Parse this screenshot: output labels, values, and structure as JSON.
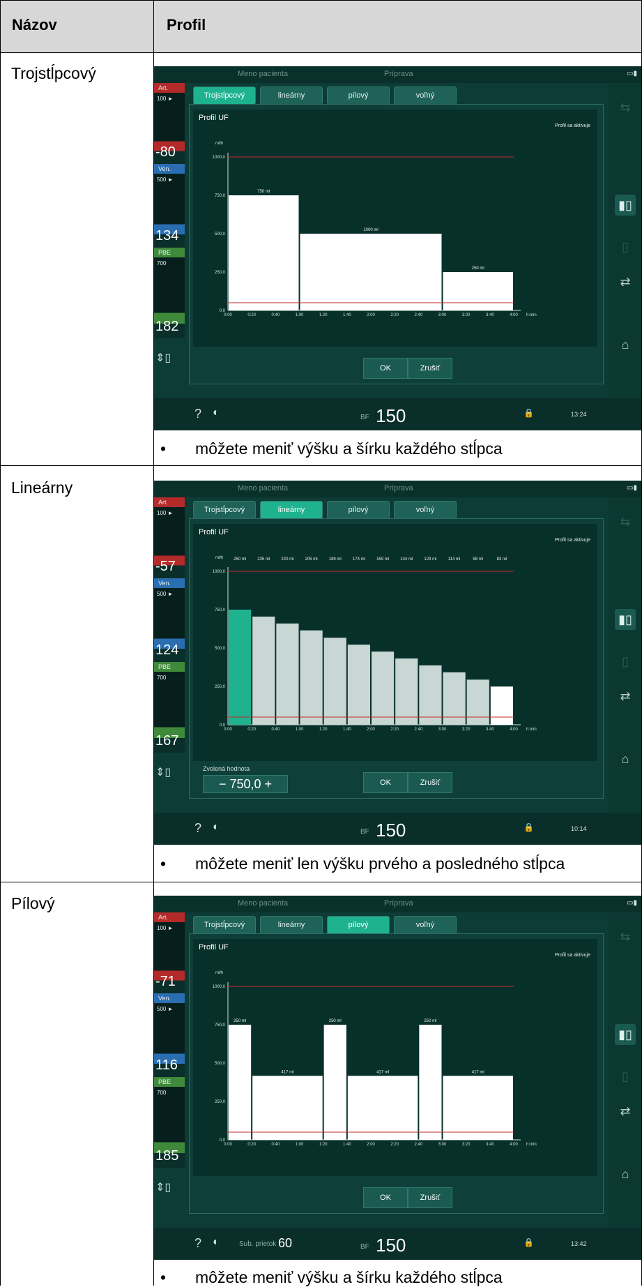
{
  "header": {
    "col1": "Názov",
    "col2": "Profil"
  },
  "rows": [
    {
      "name": "Trojstĺpcový",
      "note": "môžete meniť výšku a šírku každého stĺpca",
      "screen": {
        "patient": "Meno pacienta",
        "phase": "Príprava",
        "tabs": [
          "Trojstĺpcový",
          "lineárny",
          "pílový",
          "voľný"
        ],
        "active_tab": 0,
        "panel_title": "Profil UF",
        "status": "Profil sa aktivuje",
        "art_label": "Art.",
        "art_value": "-80",
        "ven_label": "Ven.",
        "ven_value": "134",
        "pbe_label": "PBE",
        "pbe_value": "182",
        "art_top": "100 ►",
        "ven_top": "500 ►",
        "pbe_top": "700",
        "bf_label": "BF",
        "bf_value": "150",
        "time": "13:24",
        "ok": "OK",
        "cancel": "Zrušiť",
        "bar_labels": [
          "750 ml",
          "1000 ml",
          "250 ml"
        ]
      }
    },
    {
      "name": "Lineárny",
      "note": "môžete meniť len výšku prvého a posledného stĺpca",
      "screen": {
        "patient": "Meno pacienta",
        "phase": "Príprava",
        "tabs": [
          "Trojstĺpcový",
          "lineárny",
          "pílový",
          "voľný"
        ],
        "active_tab": 1,
        "panel_title": "Profil UF",
        "status": "Profil sa aktivuje",
        "art_label": "Art.",
        "art_value": "-57",
        "ven_label": "Ven.",
        "ven_value": "124",
        "pbe_label": "PBE",
        "pbe_value": "167",
        "art_top": "100 ►",
        "ven_top": "500 ►",
        "pbe_top": "700",
        "bf_label": "BF",
        "bf_value": "150",
        "time": "10:14",
        "ok": "OK",
        "cancel": "Zrušiť",
        "selected_label": "Zvolená hodnota",
        "selected_value": "750,0",
        "bar_labels": [
          "250 ml",
          "235 ml",
          "220 ml",
          "205 ml",
          "189 ml",
          "174 ml",
          "159 ml",
          "144 ml",
          "129 ml",
          "114 ml",
          "98 ml",
          "83 ml"
        ]
      }
    },
    {
      "name": "Pílový",
      "note": "môžete meniť výšku a šírku každého stĺpca",
      "screen": {
        "patient": "Meno pacienta",
        "phase": "Príprava",
        "tabs": [
          "Trojstĺpcový",
          "lineárny",
          "pílový",
          "voľný"
        ],
        "active_tab": 2,
        "panel_title": "Profil UF",
        "status": "Profil sa aktivuje",
        "art_label": "Art.",
        "art_value": "-71",
        "ven_label": "Ven.",
        "ven_value": "116",
        "pbe_label": "PBE",
        "pbe_value": "185",
        "art_top": "100 ►",
        "ven_top": "500 ►",
        "pbe_top": "700",
        "bf_label": "BF",
        "bf_value": "150",
        "time": "13:42",
        "sub_label": "Sub. prietok",
        "sub_value": "60",
        "ok": "OK",
        "cancel": "Zrušiť",
        "bar_labels": [
          "250 ml",
          "417 ml",
          "250 ml",
          "417 ml",
          "250 ml",
          "417 ml"
        ]
      }
    }
  ],
  "chart_data": [
    {
      "type": "bar",
      "title": "Profil UF",
      "ylabel": "ml/h",
      "xlabel": "h:min",
      "ylim": [
        0,
        1000
      ],
      "x_ticks": [
        "0:00",
        "0:20",
        "0:40",
        "1:00",
        "1:20",
        "1:40",
        "2:00",
        "2:20",
        "2:40",
        "3:00",
        "3:20",
        "3:40",
        "4:00"
      ],
      "y_ticks": [
        "0,0",
        "250,0",
        "500,0",
        "750,0",
        "1000,0"
      ],
      "segments": [
        {
          "start_min": 0,
          "end_min": 60,
          "value": 750,
          "label": "750 ml"
        },
        {
          "start_min": 60,
          "end_min": 180,
          "value": 500,
          "label": "1000 ml"
        },
        {
          "start_min": 180,
          "end_min": 240,
          "value": 250,
          "label": "250 ml"
        }
      ],
      "limit_line": 1000,
      "min_line": 50
    },
    {
      "type": "bar",
      "title": "Profil UF",
      "ylabel": "ml/h",
      "xlabel": "h:min",
      "ylim": [
        0,
        1000
      ],
      "x_ticks": [
        "0:00",
        "0:20",
        "0:40",
        "1:00",
        "1:20",
        "1:40",
        "2:00",
        "2:20",
        "2:40",
        "3:00",
        "3:20",
        "3:40",
        "4:00"
      ],
      "y_ticks": [
        "0,0",
        "250,0",
        "500,0",
        "750,0",
        "1000,0"
      ],
      "segments": [
        {
          "start_min": 0,
          "end_min": 20,
          "value": 750,
          "label": "250 ml"
        },
        {
          "start_min": 20,
          "end_min": 40,
          "value": 705,
          "label": "235 ml"
        },
        {
          "start_min": 40,
          "end_min": 60,
          "value": 660,
          "label": "220 ml"
        },
        {
          "start_min": 60,
          "end_min": 80,
          "value": 615,
          "label": "205 ml"
        },
        {
          "start_min": 80,
          "end_min": 100,
          "value": 567,
          "label": "189 ml"
        },
        {
          "start_min": 100,
          "end_min": 120,
          "value": 522,
          "label": "174 ml"
        },
        {
          "start_min": 120,
          "end_min": 140,
          "value": 477,
          "label": "159 ml"
        },
        {
          "start_min": 140,
          "end_min": 160,
          "value": 432,
          "label": "144 ml"
        },
        {
          "start_min": 160,
          "end_min": 180,
          "value": 387,
          "label": "129 ml"
        },
        {
          "start_min": 180,
          "end_min": 200,
          "value": 342,
          "label": "114 ml"
        },
        {
          "start_min": 200,
          "end_min": 220,
          "value": 294,
          "label": "98 ml"
        },
        {
          "start_min": 220,
          "end_min": 240,
          "value": 249,
          "label": "83 ml"
        }
      ],
      "labels_on_top_row": true,
      "limit_line": 1000,
      "min_line": 50
    },
    {
      "type": "bar",
      "title": "Profil UF",
      "ylabel": "ml/h",
      "xlabel": "h:min",
      "ylim": [
        0,
        1000
      ],
      "x_ticks": [
        "0:00",
        "0:20",
        "0:40",
        "1:00",
        "1:20",
        "1:40",
        "2:00",
        "2:20",
        "2:40",
        "3:00",
        "3:20",
        "3:40",
        "4:00"
      ],
      "y_ticks": [
        "0,0",
        "250,0",
        "500,0",
        "750,0",
        "1000,0"
      ],
      "segments": [
        {
          "start_min": 0,
          "end_min": 20,
          "value": 750,
          "label": "250 ml"
        },
        {
          "start_min": 20,
          "end_min": 80,
          "value": 417,
          "label": "417 ml"
        },
        {
          "start_min": 80,
          "end_min": 100,
          "value": 750,
          "label": "250 ml"
        },
        {
          "start_min": 100,
          "end_min": 160,
          "value": 417,
          "label": "417 ml"
        },
        {
          "start_min": 160,
          "end_min": 180,
          "value": 750,
          "label": "250 ml"
        },
        {
          "start_min": 180,
          "end_min": 240,
          "value": 417,
          "label": "417 ml"
        }
      ],
      "limit_line": 1000,
      "min_line": 50
    }
  ],
  "colors": {
    "screen_bg": "#0d3b35",
    "tab_active": "#1fb28f",
    "bar": "#ffffff",
    "bar_dim": "#c8d7d4",
    "bar_selected": "#1fb28f",
    "art": "#b22a2a",
    "ven": "#2a6eb2",
    "pbe": "#3f8a3a",
    "limit": "#c02a2a"
  }
}
